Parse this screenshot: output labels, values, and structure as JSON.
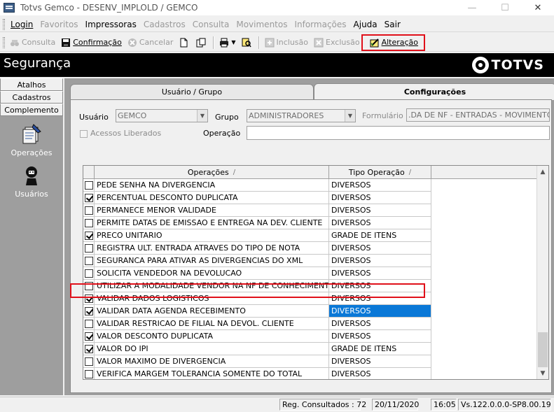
{
  "window": {
    "title": "Totvs Gemco - DESENV_IMPLOLD / GEMCO"
  },
  "menu": {
    "login": "Login",
    "favoritos": "Favoritos",
    "impressoras": "Impressoras",
    "cadastros": "Cadastros",
    "consulta": "Consulta",
    "movimentos": "Movimentos",
    "informacoes": "Informações",
    "ajuda": "Ajuda",
    "sair": "Sair"
  },
  "toolbar": {
    "consulta": "Consulta",
    "confirmacao": "Confirmação",
    "cancelar": "Cancelar",
    "inclusao": "Inclusão",
    "exclusao": "Exclusão",
    "alteracao": "Alteração"
  },
  "header": {
    "title": "Segurança",
    "logo": "TOTVS"
  },
  "left": {
    "tabs": [
      "Atalhos",
      "Cadastros",
      "Complemento"
    ],
    "operacoes": "Operações",
    "usuarios": "Usuários"
  },
  "tabs": {
    "usuario_grupo": "Usuário / Grupo",
    "configuracoes": "Configurações"
  },
  "form": {
    "usuario_label": "Usuário",
    "usuario_value": "GEMCO",
    "grupo_label": "Grupo",
    "grupo_value": "ADMINISTRADORES",
    "formulario_label": "Formulário",
    "formulario_value": ".DA DE NF - ENTRADAS - MOVIMENTOS",
    "acessos_label": "Acessos Liberados",
    "operacao_label": "Operação",
    "operacao_value": ""
  },
  "grid": {
    "col_operacoes": "Operações",
    "col_tipo": "Tipo Operação",
    "sort_glyph": "/",
    "rows": [
      {
        "checked": false,
        "op": "PEDE SENHA NA DIVERGENCIA",
        "tipo": "DIVERSOS"
      },
      {
        "checked": true,
        "op": "PERCENTUAL DESCONTO DUPLICATA",
        "tipo": "DIVERSOS"
      },
      {
        "checked": false,
        "op": "PERMANECE MENOR VALIDADE",
        "tipo": "DIVERSOS"
      },
      {
        "checked": false,
        "op": "PERMITE DATAS DE EMISSAO E ENTREGA NA DEV. CLIENTE",
        "tipo": "DIVERSOS"
      },
      {
        "checked": true,
        "op": "PRECO UNITARIO",
        "tipo": "GRADE DE ITENS"
      },
      {
        "checked": false,
        "op": "REGISTRA ULT. ENTRADA ATRAVES DO TIPO DE NOTA",
        "tipo": "DIVERSOS"
      },
      {
        "checked": false,
        "op": "SEGURANCA PARA ATIVAR AS DIVERGENCIAS DO XML",
        "tipo": "DIVERSOS"
      },
      {
        "checked": false,
        "op": "SOLICITA VENDEDOR NA DEVOLUCAO",
        "tipo": "DIVERSOS"
      },
      {
        "checked": false,
        "op": "UTILIZAR A MODALIDADE VENDOR NA NF DE CONHECIMENTO",
        "tipo": "DIVERSOS"
      },
      {
        "checked": true,
        "op": "VALIDAR DADOS LOGISTICOS",
        "tipo": "DIVERSOS"
      },
      {
        "checked": true,
        "op": "VALIDAR DATA AGENDA RECEBIMENTO",
        "tipo": "DIVERSOS",
        "selected": true
      },
      {
        "checked": false,
        "op": "VALIDAR RESTRICAO DE FILIAL NA DEVOL. CLIENTE",
        "tipo": "DIVERSOS"
      },
      {
        "checked": true,
        "op": "VALOR DESCONTO DUPLICATA",
        "tipo": "DIVERSOS"
      },
      {
        "checked": true,
        "op": "VALOR DO IPI",
        "tipo": "GRADE DE ITENS"
      },
      {
        "checked": false,
        "op": "VALOR MAXIMO DE DIVERGENCIA",
        "tipo": "DIVERSOS"
      },
      {
        "checked": false,
        "op": "VERIFICA MARGEM TOLERANCIA SOMENTE DO TOTAL",
        "tipo": "DIVERSOS"
      }
    ]
  },
  "status": {
    "reg": "Reg. Consultados : 72",
    "date": "20/11/2020",
    "time": "16:05",
    "version": "Vs.122.0.0.0-SP8.00.19"
  },
  "colors": {
    "highlight": "#e0101a",
    "selection": "#0a78d7"
  }
}
